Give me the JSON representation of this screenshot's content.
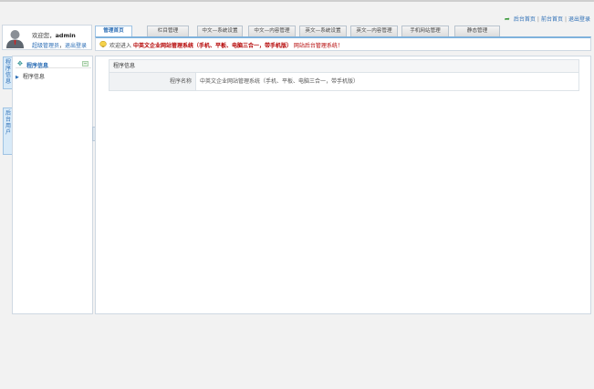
{
  "top_links": {
    "admin_home": "后台首页",
    "site_home": "前台首页",
    "logout": "退出登录",
    "separator": "|"
  },
  "user": {
    "welcome_prefix": "欢迎您，",
    "username": "admin",
    "role": "超级管理员",
    "dot": "，",
    "logout": "退出登录"
  },
  "side_tabs": [
    {
      "label": "程序信息"
    },
    {
      "label": "后台用户"
    }
  ],
  "left_menu": {
    "title": "程序信息",
    "collapse_symbol": "−",
    "items": [
      {
        "label": "程序信息"
      }
    ]
  },
  "tabs": [
    {
      "label": "管理首页",
      "active": true
    },
    {
      "label": "栏目管理"
    },
    {
      "label": "中文—系统设置"
    },
    {
      "label": "中文—内容管理"
    },
    {
      "label": "英文—系统设置"
    },
    {
      "label": "英文—内容管理"
    },
    {
      "label": "手机网站管理"
    },
    {
      "label": "静态管理"
    }
  ],
  "welcome_bar": {
    "prefix": "欢迎进入",
    "system_name": "中英文企业网站管理系统（手机、平板、电脑三合一，带手机版）",
    "suffix": "网站后台管理系统！"
  },
  "info": {
    "heading": "程序信息",
    "rows": [
      {
        "key": "程序名称",
        "value": "中英文企业网站管理系统（手机、平板、电脑三合一，带手机版）"
      }
    ]
  },
  "colors": {
    "accent": "#2a6db5",
    "highlight": "#b30000",
    "border": "#cfd8e2"
  }
}
